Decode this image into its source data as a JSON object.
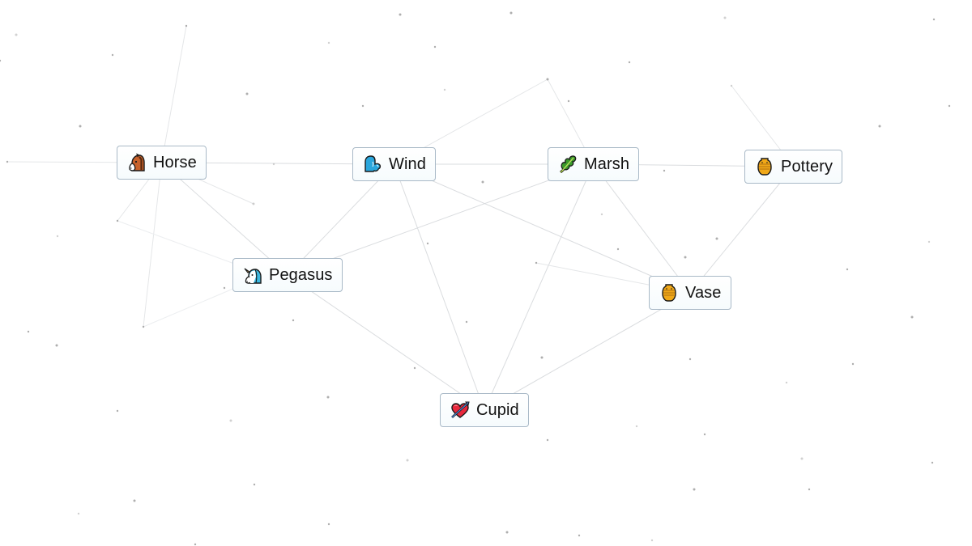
{
  "app": {
    "name": "Infinite Craft canvas"
  },
  "nodes": [
    {
      "id": "horse",
      "label": "Horse",
      "icon": "horse-face-icon"
    },
    {
      "id": "wind",
      "label": "Wind",
      "icon": "wind-face-icon"
    },
    {
      "id": "marsh",
      "label": "Marsh",
      "icon": "herb-leaf-icon"
    },
    {
      "id": "pottery",
      "label": "Pottery",
      "icon": "amphora-icon"
    },
    {
      "id": "pegasus",
      "label": "Pegasus",
      "icon": "unicorn-face-icon"
    },
    {
      "id": "vase",
      "label": "Vase",
      "icon": "amphora-icon"
    },
    {
      "id": "cupid",
      "label": "Cupid",
      "icon": "heart-with-arrow-icon"
    }
  ],
  "connections": [
    [
      "horse",
      "wind"
    ],
    [
      "horse",
      "pegasus"
    ],
    [
      "wind",
      "marsh"
    ],
    [
      "wind",
      "pegasus"
    ],
    [
      "wind",
      "cupid"
    ],
    [
      "wind",
      "vase"
    ],
    [
      "marsh",
      "pottery"
    ],
    [
      "marsh",
      "vase"
    ],
    [
      "marsh",
      "cupid"
    ],
    [
      "marsh",
      "pegasus"
    ],
    [
      "pottery",
      "vase"
    ],
    [
      "pegasus",
      "cupid"
    ],
    [
      "vase",
      "cupid"
    ]
  ],
  "colors": {
    "background": "#ffffff",
    "node_border": "#a9b9c7",
    "line": "#d6d9dc",
    "dot": "#9a9a9a",
    "text": "#111111"
  }
}
